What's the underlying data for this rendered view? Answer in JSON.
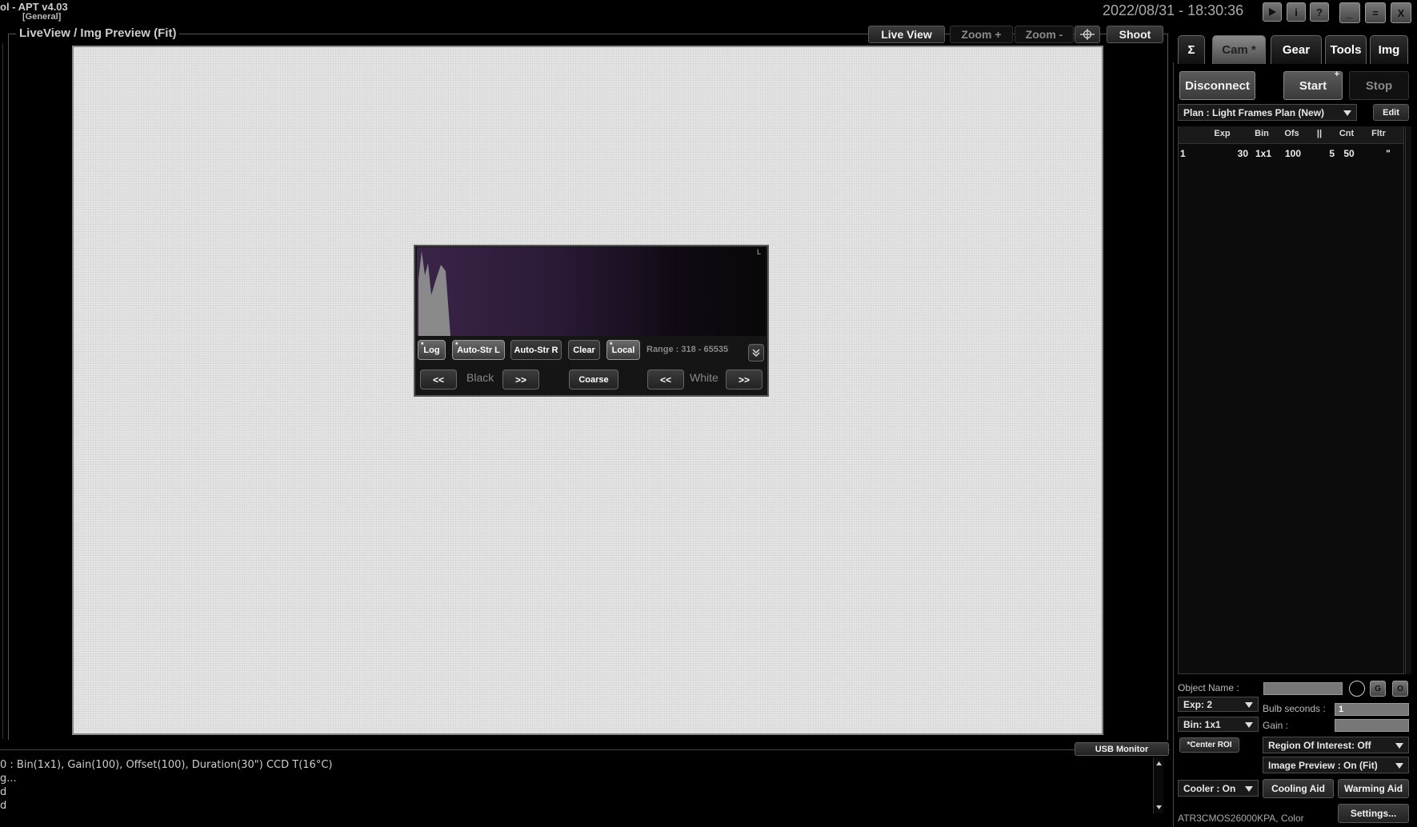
{
  "window": {
    "title": "ol  -  APT v4.03",
    "subtitle": "[General]",
    "datetime": "2022/08/31 - 18:30:36",
    "controls": [
      "_",
      "=",
      "X"
    ],
    "icon_buttons": [
      "play-icon",
      "info-icon",
      "help-icon"
    ],
    "icon_labels": [
      "i",
      "?"
    ]
  },
  "preview": {
    "title": "LiveView / Img Preview (Fit)",
    "toolbar": {
      "live_view": "Live View",
      "zoom_in": "Zoom +",
      "zoom_out": "Zoom -",
      "crosshair_icon": "crosshair-icon",
      "shoot": "Shoot"
    }
  },
  "histogram": {
    "corner_label": "L",
    "log": "Log",
    "auto_str_l": "Auto-Str L",
    "auto_str_r": "Auto-Str R",
    "clear": "Clear",
    "local": "Local",
    "star": "*",
    "range": "Range : 318 - 65535",
    "black_left": "<<",
    "black_label": "Black",
    "black_right": ">>",
    "coarse": "Coarse",
    "white_left": "<<",
    "white_label": "White",
    "white_right": ">>"
  },
  "tabs": [
    {
      "label": "Σ",
      "active": false
    },
    {
      "label": "Cam *",
      "active": true
    },
    {
      "label": "Gear",
      "active": false
    },
    {
      "label": "Tools",
      "active": false
    },
    {
      "label": "Img",
      "active": false
    }
  ],
  "cam": {
    "disconnect": "Disconnect",
    "start": "Start",
    "start_mark": "+",
    "stop": "Stop",
    "plan": "Plan : Light Frames Plan (New)",
    "edit": "Edit",
    "table": {
      "headers": [
        "Exp",
        "Bin",
        "Ofs",
        "||",
        "Cnt",
        "Fltr"
      ],
      "rows": [
        {
          "idx": "1",
          "exp": "30",
          "bin": "1x1",
          "ofs": "100",
          "pause": "5",
          "cnt": "50",
          "fltr": "\""
        }
      ]
    },
    "object_name_label": "Object Name :",
    "object_name_value": "",
    "g_button": "G",
    "o_button": "O",
    "exp": "Exp: 2",
    "bin": "Bin: 1x1",
    "bulb_label": "Bulb seconds :",
    "bulb_value": "1",
    "gain_label": "Gain :",
    "gain_value": "",
    "center_roi": "*Center ROI",
    "roi": "Region Of Interest: Off",
    "image_preview": "Image Preview : On (Fit)",
    "cooler": "Cooler : On",
    "cooling_aid": "Cooling Aid",
    "warming_aid": "Warming Aid",
    "camera": "ATR3CMOS26000KPA, Color",
    "settings": "Settings..."
  },
  "log": {
    "usb_monitor": "USB Monitor",
    "lines": [
      "0 : Bin(1x1), Gain(100), Offset(100), Duration(30\") CCD T(16°C)",
      "g...",
      "d",
      "d"
    ]
  },
  "colors": {
    "background": "#000000",
    "preview_image": "#e6e6e6",
    "histogram_gradient": "#3a2448"
  }
}
